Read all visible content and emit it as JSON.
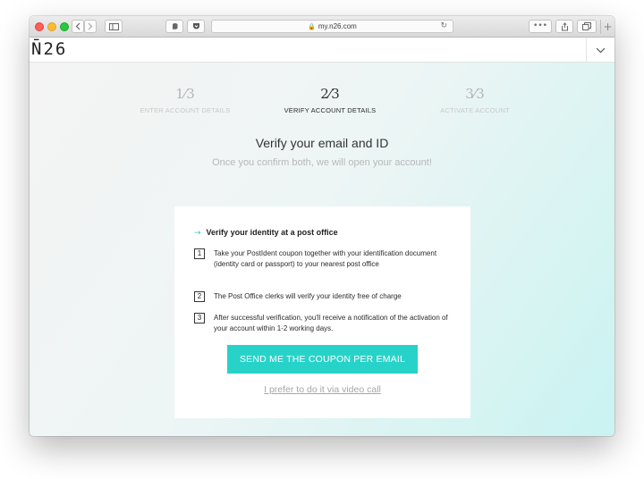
{
  "browser": {
    "url": "my.n26.com",
    "lock_icon": "lock-icon",
    "back_icon": "chevron-left-icon",
    "forward_icon": "chevron-right-icon",
    "reload_glyph": "↻",
    "more_glyph": "•••",
    "new_tab_glyph": "+",
    "colors": {
      "close": "#fd5f57",
      "minimize": "#febc2e",
      "zoom": "#28c840"
    }
  },
  "site": {
    "logo": "N̄26",
    "menu_icon": "chevron-down-icon"
  },
  "steps": [
    {
      "number": "1⁄3",
      "label": "ENTER ACCOUNT DETAILS",
      "active": false
    },
    {
      "number": "2⁄3",
      "label": "VERIFY ACCOUNT DETAILS",
      "active": true
    },
    {
      "number": "3⁄3",
      "label": "ACTIVATE ACCOUNT",
      "active": false
    }
  ],
  "main": {
    "title": "Verify your email and ID",
    "subtitle": "Once you confirm both, we will open your account!"
  },
  "card": {
    "arrow": "→",
    "title": "Verify your identity at a post office",
    "items": [
      {
        "number": "1",
        "text": "Take your PostIdent coupon together with your identification document (identity card or passport) to your nearest post office"
      },
      {
        "number": "2",
        "text": "The Post Office clerks will verify your identity free of charge"
      },
      {
        "number": "3",
        "text": "After successful verification, you'll receive a notification of the activation of your account within 1-2 working days."
      }
    ],
    "cta_label": "SEND ME THE COUPON PER EMAIL",
    "alt_link": "I prefer to do it via video call"
  },
  "colors": {
    "accent": "#27d3c9"
  }
}
